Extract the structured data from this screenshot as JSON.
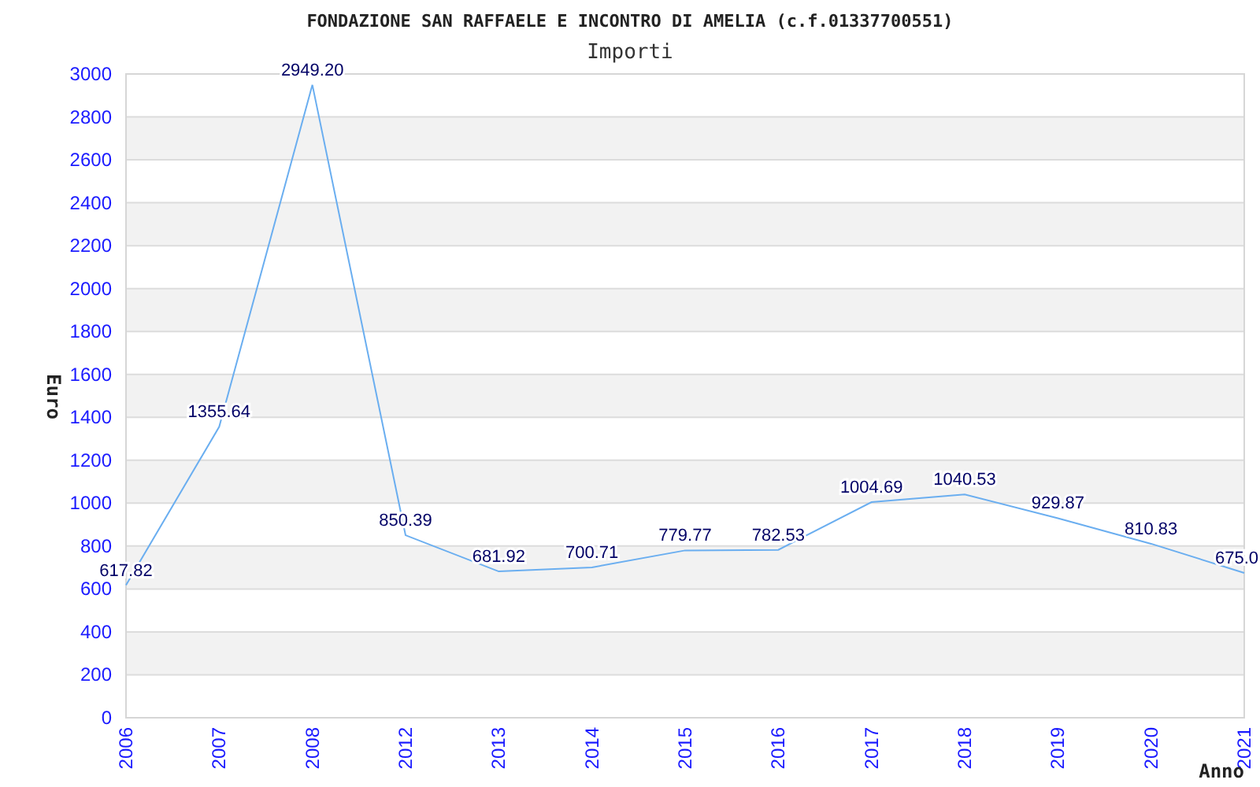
{
  "chart_data": {
    "type": "line",
    "title": "FONDAZIONE SAN RAFFAELE E INCONTRO DI AMELIA (c.f.01337700551)",
    "grid": true,
    "xlabel": "Anno",
    "ylabel": "Euro",
    "categories": [
      "2006",
      "2007",
      "2008",
      "2012",
      "2013",
      "2014",
      "2015",
      "2016",
      "2017",
      "2018",
      "2019",
      "2020",
      "2021"
    ],
    "series": [
      {
        "name": "Importi",
        "color": "#6aaef0",
        "values": [
          617.82,
          1355.64,
          2949.2,
          850.39,
          681.92,
          700.71,
          779.77,
          782.53,
          1004.69,
          1040.53,
          929.87,
          810.83,
          675.0
        ]
      }
    ],
    "value_labels": [
      "617.82",
      "1355.64",
      "2949.20",
      "850.39",
      "681.92",
      "700.71",
      "779.77",
      "782.53",
      "1004.69",
      "1040.53",
      "929.87",
      "810.83",
      "675.0"
    ],
    "ylim": [
      0,
      3000
    ],
    "yticks": [
      0,
      200,
      400,
      600,
      800,
      1000,
      1200,
      1400,
      1600,
      1800,
      2000,
      2200,
      2400,
      2600,
      2800,
      3000
    ]
  }
}
